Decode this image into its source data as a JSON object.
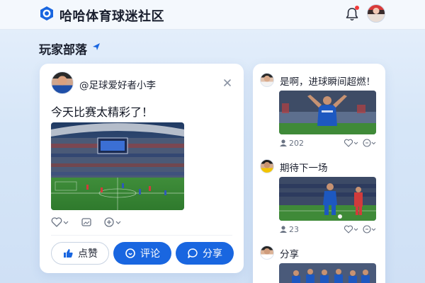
{
  "header": {
    "app_title": "哈哈体育球迷社区",
    "logo_icon": "hexagon-logo-icon",
    "notification_icon": "bell-icon",
    "colors": {
      "brand": "#1966e0",
      "notification_dot": "#f23b3b"
    }
  },
  "section": {
    "title": "玩家部落"
  },
  "post": {
    "username": "@足球爱好者小李",
    "text": "今天比赛太精彩了！",
    "image_subject": "stadium-match-photo",
    "actions": {
      "like_label": "点赞",
      "comment_label": "评论",
      "share_label": "分享"
    }
  },
  "feed": {
    "items": [
      {
        "title": "是啊，进球瞬间超燃！",
        "count": "202",
        "image_subject": "player-celebration-photo"
      },
      {
        "title": "期待下一场",
        "count": "23",
        "image_subject": "player-dribbling-photo"
      },
      {
        "title": "分享",
        "image_subject": "team-lineup-photo"
      }
    ]
  }
}
